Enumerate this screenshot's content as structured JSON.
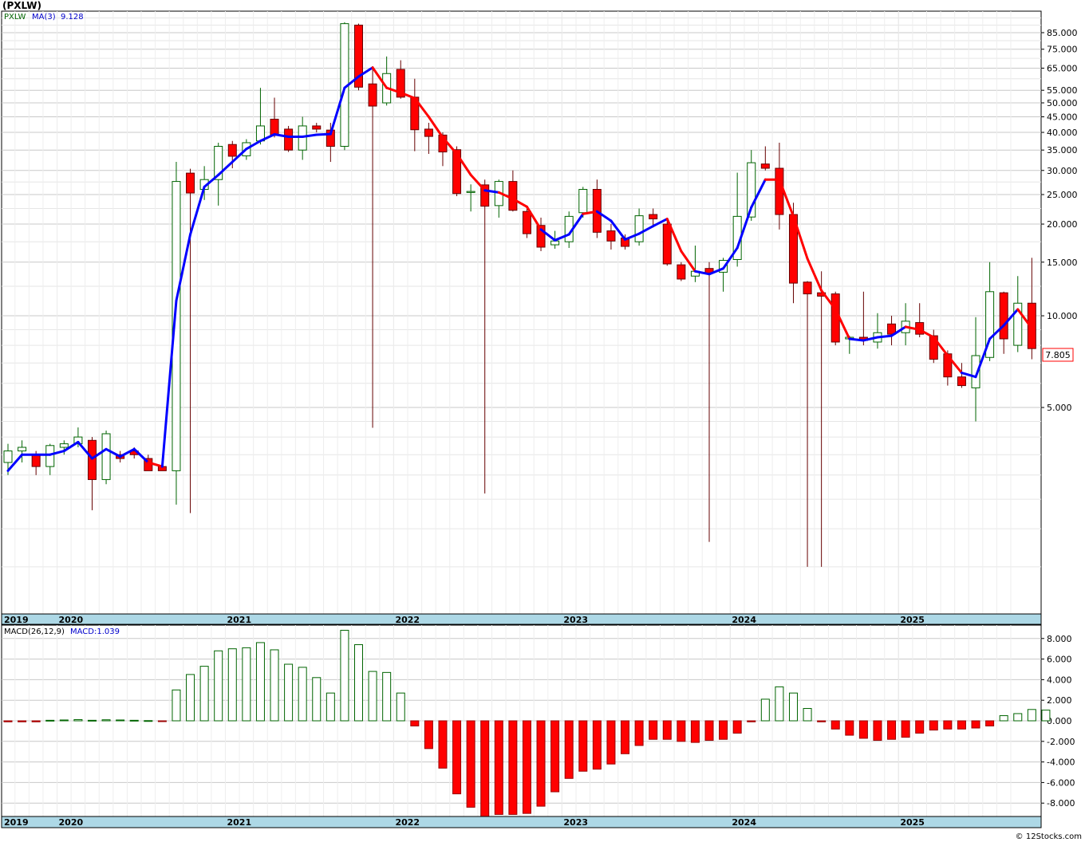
{
  "title": "(PXLW)",
  "price_panel": {
    "legend_symbol": "PXLW",
    "legend_ma": "MA(3)",
    "legend_ma_value": "9.128",
    "last_price_label": "7.805"
  },
  "macd_panel": {
    "legend_name": "MACD(26,12,9)",
    "legend_value": "MACD:1.039"
  },
  "footer": "© 12Stocks.com",
  "colors": {
    "up": "#006400",
    "down": "#ff0000",
    "ma_up": "#0000ff",
    "ma_down": "#ff0000",
    "axis_band": "#add8e6",
    "grid": "#c8c8c8",
    "wick": "#660000"
  },
  "chart_data": [
    {
      "type": "candlestick",
      "scale": "log",
      "ylim": [
        1.05,
        100
      ],
      "y_ticks": [
        5,
        10,
        15,
        20,
        25,
        30,
        35,
        40,
        45,
        50,
        55,
        65,
        75,
        85
      ],
      "y_tick_labels": [
        "5.000",
        "10.000",
        "15.000",
        "20.000",
        "25.000",
        "30.000",
        "35.000",
        "40.000",
        "45.000",
        "50.000",
        "55.000",
        "65.000",
        "75.000",
        "85.000"
      ],
      "x_labels": [
        "2019",
        "2020",
        "2021",
        "2022",
        "2023",
        "2024",
        "2025"
      ],
      "x_label_months": [
        0,
        4,
        16,
        28,
        40,
        52,
        64
      ],
      "months": 73,
      "ohlc": [
        [
          3.3,
          3.8,
          3.0,
          3.6
        ],
        [
          3.6,
          3.9,
          3.3,
          3.7
        ],
        [
          3.5,
          3.6,
          3.0,
          3.2
        ],
        [
          3.2,
          3.8,
          3.0,
          3.75
        ],
        [
          3.7,
          3.9,
          3.5,
          3.8
        ],
        [
          3.8,
          4.3,
          3.7,
          4.0
        ],
        [
          3.9,
          4.0,
          2.3,
          2.9
        ],
        [
          2.9,
          4.2,
          2.8,
          4.1
        ],
        [
          3.5,
          3.6,
          3.3,
          3.4
        ],
        [
          3.6,
          3.7,
          3.4,
          3.5
        ],
        [
          3.4,
          3.5,
          3.1,
          3.1
        ],
        [
          3.2,
          3.4,
          3.1,
          3.1
        ],
        [
          3.1,
          32.0,
          2.4,
          27.6
        ],
        [
          29.4,
          30.4,
          2.25,
          25.3
        ],
        [
          26.0,
          31.0,
          24.0,
          28.0
        ],
        [
          28.0,
          37.0,
          23.0,
          36.0
        ],
        [
          36.5,
          37.5,
          30.5,
          33.4
        ],
        [
          33.5,
          38.0,
          32.5,
          37.0
        ],
        [
          37.5,
          56.0,
          36.5,
          42.0
        ],
        [
          44.2,
          52.0,
          38.5,
          39.1
        ],
        [
          41.0,
          42.0,
          34.5,
          35.0
        ],
        [
          35.0,
          45.0,
          32.5,
          42.0
        ],
        [
          42.0,
          43.0,
          40.0,
          41.0
        ],
        [
          40.7,
          43.0,
          32.0,
          36.0
        ],
        [
          36.0,
          92.0,
          35.0,
          91.0
        ],
        [
          90.0,
          91.0,
          55.0,
          56.3
        ],
        [
          57.7,
          66.0,
          4.29,
          48.8
        ],
        [
          50.0,
          71.0,
          49.0,
          62.4
        ],
        [
          64.4,
          69.0,
          51.6,
          52.2
        ],
        [
          52.2,
          60.0,
          34.7,
          40.8
        ],
        [
          41.0,
          43.0,
          34.0,
          38.8
        ],
        [
          39.2,
          40.0,
          31.0,
          34.5
        ],
        [
          35.1,
          36.0,
          24.7,
          25.2
        ],
        [
          25.4,
          27.0,
          22.0,
          25.6
        ],
        [
          26.9,
          28.0,
          2.61,
          22.9
        ],
        [
          23.0,
          28.0,
          21.0,
          27.6
        ],
        [
          27.6,
          30.0,
          22.0,
          22.2
        ],
        [
          22.0,
          23.0,
          18.0,
          18.6
        ],
        [
          19.8,
          21.0,
          16.3,
          16.8
        ],
        [
          17.1,
          19.0,
          16.6,
          17.6
        ],
        [
          17.5,
          22.0,
          16.7,
          21.2
        ],
        [
          21.8,
          26.5,
          21.0,
          26.0
        ],
        [
          26.0,
          28.0,
          18.0,
          18.8
        ],
        [
          19.0,
          20.0,
          16.5,
          17.6
        ],
        [
          18.0,
          18.5,
          16.5,
          16.9
        ],
        [
          17.5,
          22.5,
          17.0,
          21.3
        ],
        [
          21.5,
          22.5,
          19.5,
          20.8
        ],
        [
          20.0,
          21.0,
          14.6,
          14.8
        ],
        [
          14.7,
          15.0,
          13.0,
          13.2
        ],
        [
          13.5,
          17.0,
          12.9,
          14.0
        ],
        [
          14.3,
          15.0,
          1.81,
          13.8
        ],
        [
          13.9,
          15.5,
          12.0,
          15.2
        ],
        [
          15.3,
          29.5,
          14.5,
          21.2
        ],
        [
          21.1,
          35.0,
          20.5,
          31.8
        ],
        [
          31.5,
          36.0,
          30.0,
          30.5
        ],
        [
          30.5,
          37.0,
          19.2,
          21.5
        ],
        [
          21.5,
          23.5,
          11.0,
          12.8
        ],
        [
          12.9,
          13.0,
          1.5,
          11.8
        ],
        [
          11.9,
          14.0,
          1.5,
          11.6
        ],
        [
          11.8,
          12.0,
          8.0,
          8.2
        ],
        [
          8.4,
          8.6,
          7.5,
          8.5
        ],
        [
          8.5,
          12.0,
          8.0,
          8.3
        ],
        [
          8.2,
          10.2,
          7.8,
          8.8
        ],
        [
          9.4,
          10.0,
          8.0,
          8.7
        ],
        [
          8.8,
          11.0,
          8.0,
          9.6
        ],
        [
          9.5,
          11.0,
          8.5,
          8.7
        ],
        [
          8.6,
          9.0,
          7.0,
          7.2
        ],
        [
          7.5,
          7.7,
          5.9,
          6.3
        ],
        [
          6.3,
          7.0,
          5.8,
          5.9
        ],
        [
          5.8,
          9.9,
          4.5,
          7.4
        ],
        [
          7.3,
          15.0,
          7.1,
          12.0
        ],
        [
          11.9,
          12.0,
          7.5,
          8.4
        ],
        [
          8.0,
          13.5,
          7.6,
          11.0
        ],
        [
          11.0,
          15.5,
          7.2,
          7.805
        ]
      ],
      "ma3": [
        3.1,
        3.5,
        3.5,
        3.5,
        3.6,
        3.85,
        3.4,
        3.65,
        3.45,
        3.65,
        3.3,
        3.2,
        11.2,
        18.5,
        26.5,
        29.0,
        32.0,
        35.3,
        37.5,
        39.4,
        38.7,
        38.7,
        39.3,
        39.5,
        56.0,
        61.0,
        65.3,
        56.0,
        54.0,
        51.8,
        45.0,
        38.5,
        34.0,
        29.0,
        25.8,
        25.4,
        24.2,
        22.8,
        19.2,
        17.7,
        18.5,
        21.6,
        22.0,
        20.5,
        17.8,
        18.6,
        19.7,
        20.8,
        16.3,
        14.0,
        13.7,
        14.3,
        16.7,
        22.7,
        28.0,
        28.0,
        21.2,
        15.4,
        12.1,
        10.5,
        8.4,
        8.3,
        8.5,
        8.6,
        9.2,
        9.0,
        8.5,
        7.4,
        6.5,
        6.3,
        8.4,
        9.3,
        10.5,
        9.1
      ],
      "ma3_dir": [
        "u",
        "u",
        "u",
        "u",
        "u",
        "u",
        "u",
        "u",
        "u",
        "u",
        "u",
        "d",
        "u",
        "u",
        "u",
        "u",
        "u",
        "u",
        "u",
        "u",
        "u",
        "u",
        "u",
        "u",
        "u",
        "u",
        "u",
        "d",
        "d",
        "d",
        "d",
        "d",
        "d",
        "d",
        "d",
        "u",
        "d",
        "d",
        "d",
        "u",
        "u",
        "u",
        "d",
        "u",
        "u",
        "u",
        "u",
        "u",
        "d",
        "d",
        "u",
        "u",
        "u",
        "u",
        "u",
        "d",
        "d",
        "d",
        "d",
        "d",
        "d",
        "u",
        "u",
        "u",
        "u",
        "d",
        "d",
        "d",
        "d",
        "u",
        "u",
        "u",
        "u",
        "d"
      ]
    },
    {
      "type": "bar",
      "name": "MACD(26,12,9)",
      "ylim": [
        -9.3,
        9.3
      ],
      "y_ticks": [
        -8,
        -6,
        -4,
        -2,
        0,
        2,
        4,
        6,
        8
      ],
      "y_tick_labels": [
        "-8.000",
        "-6.000",
        "-4.000",
        "-2.000",
        "0.000",
        "2.000",
        "4.000",
        "6.000",
        "8.000"
      ],
      "values": [
        -0.1,
        -0.1,
        -0.1,
        0.05,
        0.08,
        0.12,
        0.05,
        0.1,
        0.08,
        0.05,
        0.02,
        -0.05,
        3.0,
        4.5,
        5.3,
        6.8,
        7.0,
        7.1,
        7.6,
        6.9,
        5.5,
        5.2,
        4.2,
        2.7,
        8.8,
        7.4,
        4.8,
        4.7,
        2.7,
        -0.5,
        -2.7,
        -4.6,
        -7.1,
        -8.4,
        -9.3,
        -9.1,
        -9.1,
        -9.0,
        -8.3,
        -6.9,
        -5.6,
        -4.9,
        -4.7,
        -4.2,
        -3.2,
        -2.4,
        -1.8,
        -1.8,
        -2.0,
        -2.1,
        -1.9,
        -1.8,
        -1.2,
        -0.1,
        2.1,
        3.3,
        2.7,
        1.2,
        -0.1,
        -0.8,
        -1.4,
        -1.7,
        -1.9,
        -1.8,
        -1.6,
        -1.2,
        -0.9,
        -0.8,
        -0.8,
        -0.7,
        -0.5,
        0.5,
        0.7,
        1.1,
        1.039
      ]
    }
  ]
}
